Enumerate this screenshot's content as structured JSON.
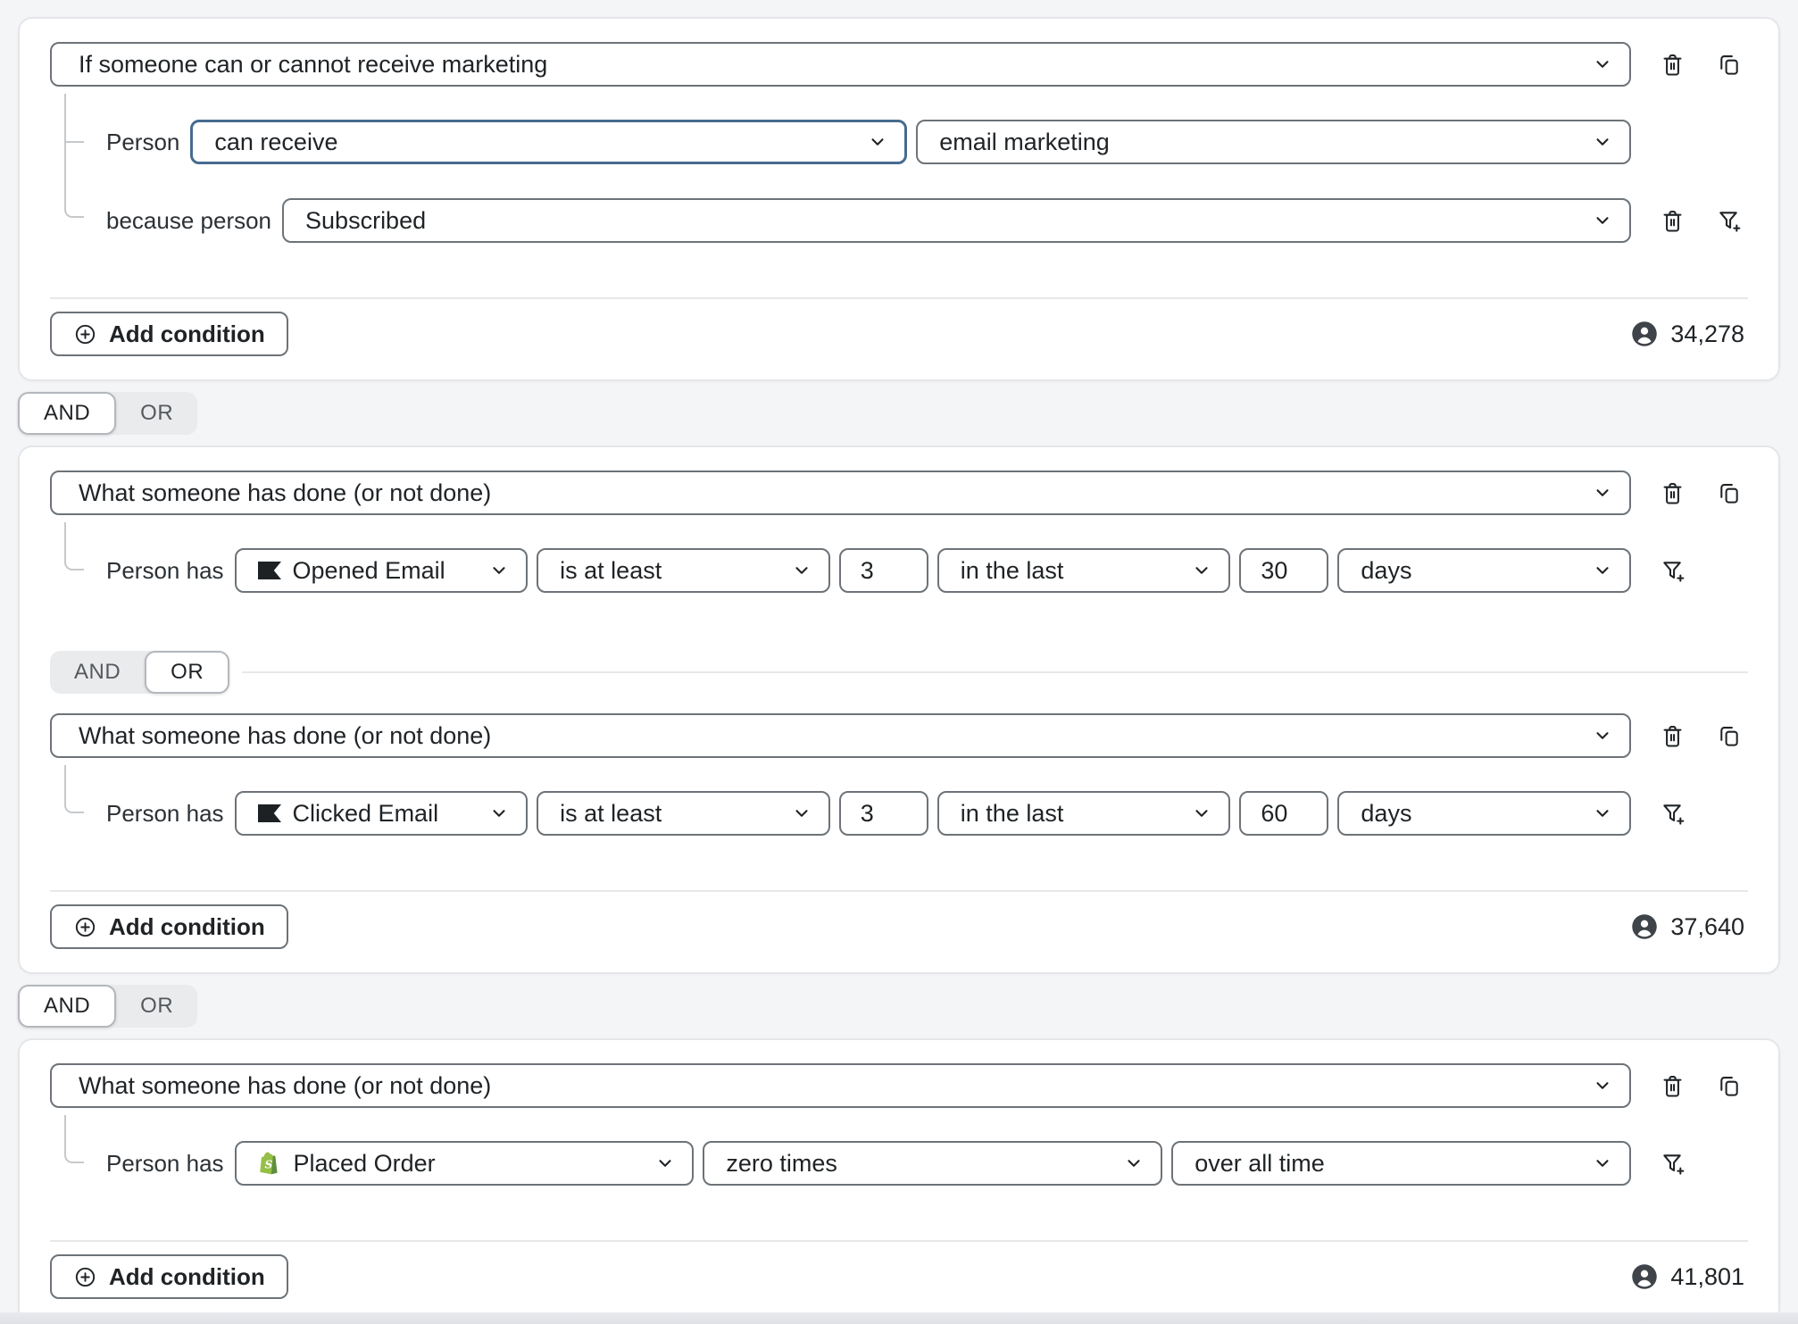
{
  "colors": {
    "page_bg": "#f4f5f7",
    "card_border": "#e4e6e9",
    "control_border": "#6d7378",
    "focus_border": "#476b8f",
    "connector": "#c6c9cc",
    "badge": "#3f444a",
    "shopify_green": "#95bf47",
    "shopify_green_dark": "#5e8e3e",
    "klaviyo_black": "#1d2124"
  },
  "icons": {
    "delete": "trash-icon",
    "duplicate": "copy-icon",
    "add_filter": "filter-plus-icon",
    "add": "plus-circle-icon",
    "profiles": "person-badge-icon",
    "dropdown": "chevron-down-icon",
    "email_event_source": "klaviyo-flag-icon",
    "order_event_source": "shopify-bag-icon"
  },
  "logic": {
    "and": "AND",
    "or": "OR"
  },
  "groups": [
    {
      "type": "If someone can or cannot receive marketing",
      "rows": [
        {
          "label": "Person",
          "selects": [
            "can receive",
            "email marketing"
          ]
        },
        {
          "label": "because person",
          "selects": [
            "Subscribed"
          ]
        }
      ],
      "add_condition": "Add condition",
      "profile_count": "34,278"
    },
    {
      "inner_operator_selected": "OR",
      "sections": [
        {
          "type": "What someone has done (or not done)",
          "row": {
            "label": "Person has",
            "event": "Opened Email",
            "event_icon": "klaviyo-flag-icon",
            "frequency": "is at least",
            "frequency_value": "3",
            "timeframe": "in the last",
            "timeframe_value": "30",
            "timeframe_unit": "days"
          }
        },
        {
          "type": "What someone has done (or not done)",
          "row": {
            "label": "Person has",
            "event": "Clicked Email",
            "event_icon": "klaviyo-flag-icon",
            "frequency": "is at least",
            "frequency_value": "3",
            "timeframe": "in the last",
            "timeframe_value": "60",
            "timeframe_unit": "days"
          }
        }
      ],
      "add_condition": "Add condition",
      "profile_count": "37,640"
    },
    {
      "type": "What someone has done (or not done)",
      "row": {
        "label": "Person has",
        "event": "Placed Order",
        "event_icon": "shopify-bag-icon",
        "frequency": "zero times",
        "timeframe": "over all time"
      },
      "add_condition": "Add condition",
      "profile_count": "41,801"
    }
  ]
}
